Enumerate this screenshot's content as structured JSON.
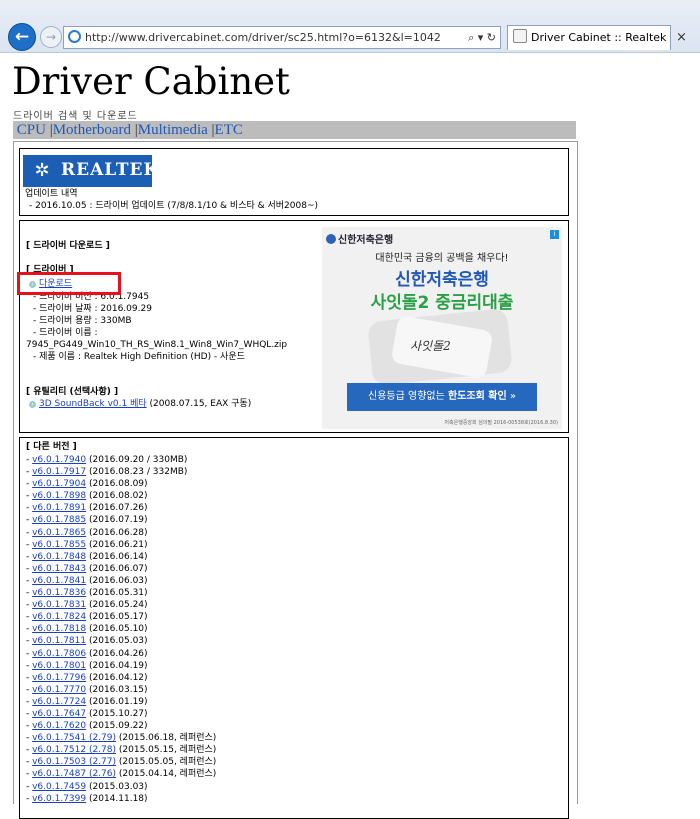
{
  "browser": {
    "url": "http://www.drivercabinet.com/driver/sc25.html?o=6132&l=1042",
    "search_icon": "search-icon",
    "refresh_icon": "refresh-icon",
    "tab_title": "Driver Cabinet :: Realtek H...",
    "close": "×"
  },
  "site": {
    "title": "Driver Cabinet",
    "subtitle": "드라이버 검색 및 다운로드",
    "menu": [
      "CPU",
      "Motherboard",
      "Multimedia",
      "ETC"
    ],
    "menu_sep": "|"
  },
  "vendor": {
    "logo_text": "REALTEK",
    "update_heading": "업데이트 내역",
    "update_line": "- 2016.10.05 : 드라이버 업데이트 (7/8/8.1/10 & 비스타 & 서버2008~)"
  },
  "download": {
    "heading": "[ 드라이버 다운로드 ]",
    "sub_heading": "[ 드라이버 ]",
    "download_link": "다운로드",
    "version_line": "- 드라이버 버전 : 6.0.1.7945",
    "date_line": "- 드라이버 날짜 : 2016.09.29",
    "size_line": "- 드라이버 용량 : 330MB",
    "name_line": "- 드라이버 이름 :",
    "file_name": "7945_PG449_Win10_TH_RS_Win8.1_Win8_Win7_WHQL.zip",
    "product_line": "- 제품 이름 : Realtek High Definition (HD) - 사운드",
    "utility_heading": "[ 유틸리티 (선택사항) ]",
    "utility_link": "3D SoundBack v0.1 베타",
    "utility_note": "(2008.07.15, EAX 구동)"
  },
  "ad": {
    "bank": "신한저축은행",
    "line1": "대한민국 금융의 공백을 채우다!",
    "line2": "신한저축은행",
    "line3": "사잇돌2 중금리대출",
    "brand": "사잇돌2",
    "cta_pre": "신용등급 영향없는 ",
    "cta_bold": "한도조회 확인",
    "cta_arrow": "»",
    "fine": "저축은행중앙회 심의필 2016-00538호(2016.8.30)"
  },
  "other_versions": {
    "heading": "[ 다른 버전 ]",
    "items": [
      {
        "link": "v6.0.1.7940",
        "note": "(2016.09.20 / 330MB)"
      },
      {
        "link": "v6.0.1.7917",
        "note": "(2016.08.23 / 332MB)"
      },
      {
        "link": "v6.0.1.7904",
        "note": "(2016.08.09)"
      },
      {
        "link": "v6.0.1.7898",
        "note": "(2016.08.02)"
      },
      {
        "link": "v6.0.1.7891",
        "note": "(2016.07.26)"
      },
      {
        "link": "v6.0.1.7885",
        "note": "(2016.07.19)"
      },
      {
        "link": "v6.0.1.7865",
        "note": "(2016.06.28)"
      },
      {
        "link": "v6.0.1.7855",
        "note": "(2016.06.21)"
      },
      {
        "link": "v6.0.1.7848",
        "note": "(2016.06.14)"
      },
      {
        "link": "v6.0.1.7843",
        "note": "(2016.06.07)"
      },
      {
        "link": "v6.0.1.7841",
        "note": "(2016.06.03)"
      },
      {
        "link": "v6.0.1.7836",
        "note": "(2016.05.31)"
      },
      {
        "link": "v6.0.1.7831",
        "note": "(2016.05.24)"
      },
      {
        "link": "v6.0.1.7824",
        "note": "(2016.05.17)"
      },
      {
        "link": "v6.0.1.7818",
        "note": "(2016.05.10)"
      },
      {
        "link": "v6.0.1.7811",
        "note": "(2016.05.03)"
      },
      {
        "link": "v6.0.1.7806",
        "note": "(2016.04.26)"
      },
      {
        "link": "v6.0.1.7801",
        "note": "(2016.04.19)"
      },
      {
        "link": "v6.0.1.7796",
        "note": "(2016.04.12)"
      },
      {
        "link": "v6.0.1.7770",
        "note": "(2016.03.15)"
      },
      {
        "link": "v6.0.1.7724",
        "note": "(2016.01.19)"
      },
      {
        "link": "v6.0.1.7647",
        "note": "(2015.10.27)"
      },
      {
        "link": "v6.0.1.7620",
        "note": "(2015.09.22)"
      },
      {
        "link": "v6.0.1.7541 (2.79)",
        "note": "(2015.06.18, 레퍼런스)"
      },
      {
        "link": "v6.0.1.7512 (2.78)",
        "note": "(2015.05.15, 레퍼런스)"
      },
      {
        "link": "v6.0.1.7503 (2.77)",
        "note": "(2015.05.05, 레퍼런스)"
      },
      {
        "link": "v6.0.1.7487 (2.76)",
        "note": "(2015.04.14, 레퍼런스)"
      },
      {
        "link": "v6.0.1.7459",
        "note": "(2015.03.03)"
      },
      {
        "link": "v6.0.1.7399",
        "note": "(2014.11.18)"
      }
    ]
  }
}
